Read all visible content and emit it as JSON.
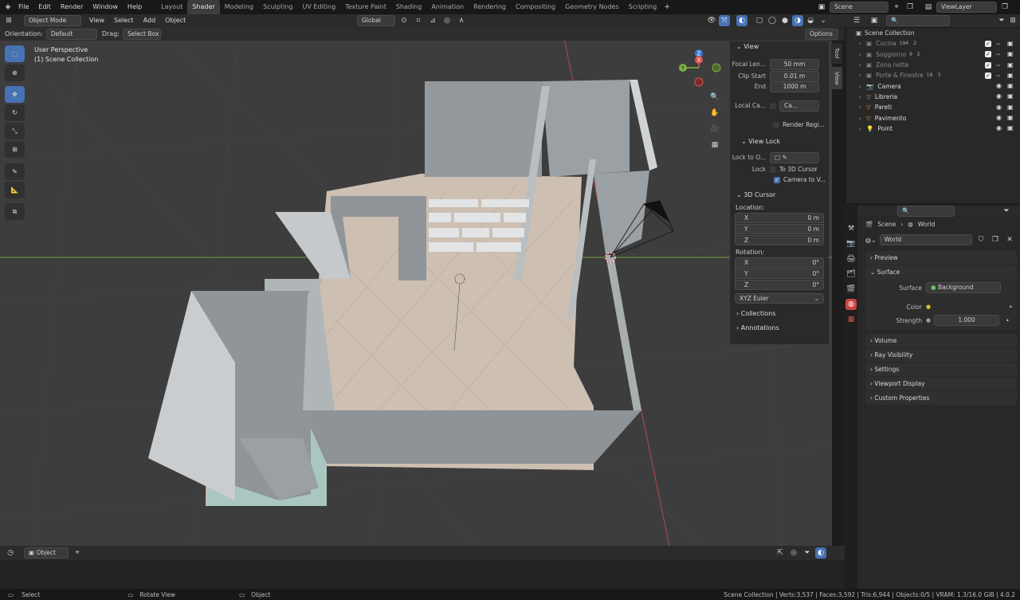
{
  "menus": [
    "File",
    "Edit",
    "Render",
    "Window",
    "Help"
  ],
  "workspaces": [
    "Layout",
    "Shader",
    "Modeling",
    "Sculpting",
    "UV Editing",
    "Texture Paint",
    "Shading",
    "Animation",
    "Rendering",
    "Compositing",
    "Geometry Nodes",
    "Scripting"
  ],
  "active_workspace": "Shader",
  "scene_name": "Scene",
  "view_layer": "ViewLayer",
  "viewport_header": {
    "mode": "Object Mode",
    "menus": [
      "View",
      "Select",
      "Add",
      "Object"
    ],
    "transform_orientation": "Global",
    "options_label": "Options"
  },
  "tool_settings": {
    "orientation_label": "Orientation:",
    "orientation_value": "Default",
    "drag_label": "Drag:",
    "drag_value": "Select Box"
  },
  "viewport_overlay": {
    "perspective": "User Perspective",
    "collection": "(1) Scene Collection"
  },
  "gizmo": {
    "x": "X",
    "y": "Y",
    "z": "Z"
  },
  "npanel": {
    "tabs": [
      "Tool",
      "View"
    ],
    "view": {
      "title": "View",
      "focal_label": "Focal Len...",
      "focal_value": "50 mm",
      "clip_start_label": "Clip Start",
      "clip_start_value": "0.01 m",
      "end_label": "End",
      "end_value": "1000 m",
      "local_camera_label": "Local Ca...",
      "local_camera_value": "Ca...",
      "render_region_label": "Render Regi..."
    },
    "view_lock": {
      "title": "View Lock",
      "lock_to_label": "Lock to O...",
      "lock_label": "Lock",
      "to_3d_cursor": "To 3D Cursor",
      "camera_to_view": "Camera to V..."
    },
    "cursor": {
      "title": "3D Cursor",
      "location_label": "Location:",
      "rotation_label": "Rotation:",
      "loc": [
        {
          "axis": "X",
          "value": "0 m"
        },
        {
          "axis": "Y",
          "value": "0 m"
        },
        {
          "axis": "Z",
          "value": "0 m"
        }
      ],
      "rot": [
        {
          "axis": "X",
          "value": "0°"
        },
        {
          "axis": "Y",
          "value": "0°"
        },
        {
          "axis": "Z",
          "value": "0°"
        }
      ],
      "rotation_mode": "XYZ Euler"
    },
    "collections": "Collections",
    "annotations": "Annotations"
  },
  "outliner": {
    "root": "Scene Collection",
    "items": [
      {
        "name": "Cucina",
        "badge": "194",
        "badge2": "2",
        "dim": true,
        "checked": true
      },
      {
        "name": "Soggiorno",
        "badge": "9",
        "badge2": "2",
        "dim": true,
        "checked": true
      },
      {
        "name": "Zona notte",
        "badge": "",
        "badge2": "",
        "dim": true,
        "checked": true
      },
      {
        "name": "Porte & Finestre",
        "badge": "18",
        "badge2": "3",
        "dim": true,
        "checked": true
      },
      {
        "name": "Camera",
        "badge": "",
        "badge2": "",
        "dim": false,
        "checked": false
      },
      {
        "name": "Libreria",
        "badge": "",
        "badge2": "",
        "dim": false,
        "checked": false
      },
      {
        "name": "Pareti",
        "badge": "",
        "badge2": "",
        "dim": false,
        "checked": false
      },
      {
        "name": "Pavimento",
        "badge": "",
        "badge2": "",
        "dim": false,
        "checked": false
      },
      {
        "name": "Point",
        "badge": "",
        "badge2": "",
        "dim": false,
        "checked": false
      }
    ]
  },
  "properties": {
    "breadcrumb_scene": "Scene",
    "breadcrumb_world": "World",
    "world_name": "World",
    "sections": [
      "Preview",
      "Surface"
    ],
    "surface_label": "Surface",
    "surface_value": "Background",
    "color_label": "Color",
    "strength_label": "Strength",
    "strength_value": "1.000",
    "collapsed": [
      "Volume",
      "Ray Visibility",
      "Settings",
      "Viewport Display",
      "Custom Properties"
    ]
  },
  "timeline_header": {
    "mode": "Object"
  },
  "statusbar": {
    "select": "Select",
    "rotate": "Rotate View",
    "object": "Object",
    "stats": "Scene Collection | Verts:3,537 | Faces:3,592 | Tris:6,944 | Objects:0/5 | VRAM: 1.3/16.0 GiB | 4.0.2"
  },
  "colors": {
    "accent": "#4772b3",
    "xaxis": "#d9534f",
    "yaxis": "#7cb342",
    "zaxis": "#3a7bd5"
  }
}
